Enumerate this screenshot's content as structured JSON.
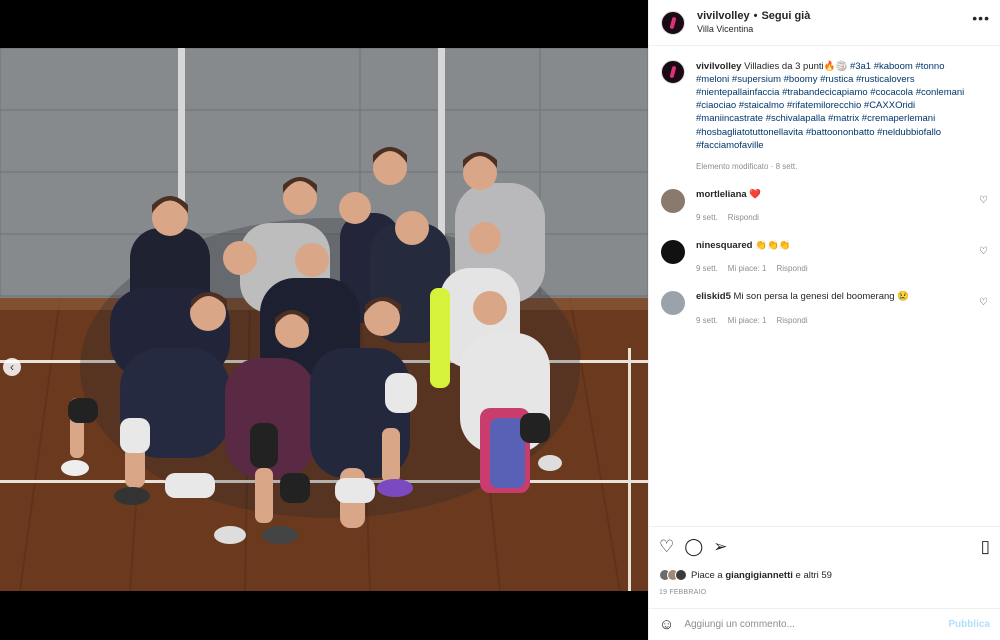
{
  "post": {
    "username": "vivilvolley",
    "separator": "•",
    "follow_label": "Segui già",
    "location": "Villa Vicentina",
    "more_icon": "more-options-icon"
  },
  "caption": {
    "username": "vivilvolley",
    "text": "Villadies da 3 punti🔥🏐 ",
    "hashtags": "#3a1 #kaboom #tonno #meloni #supersium #boomy #rustica #rusticalovers #nientepallainfaccia #trabandecicapiamo #cocacola #conlemani #ciaociao #staicalmo #rifatemilorecchio #CAXXOridi #maniincastrate #schivalapalla #matrix #cremaperlemani #hosbagliatotuttonellavita #battoononbatto #neldubbiofallo #facciamofaville",
    "meta": "Elemento modificato · 8 sett."
  },
  "comments": [
    {
      "username": "mortleliana",
      "text": "❤️",
      "time": "9 sett.",
      "likes": "",
      "reply_label": "Rispondi",
      "avatar_color": "#8a7a6e"
    },
    {
      "username": "ninesquared",
      "text": "👏👏👏",
      "time": "9 sett.",
      "likes": "Mi piace: 1",
      "reply_label": "Rispondi",
      "avatar_color": "#111111"
    },
    {
      "username": "eliskid5",
      "text": "Mi son persa la genesi del boomerang 😢",
      "time": "9 sett.",
      "likes": "Mi piace: 1",
      "reply_label": "Rispondi",
      "avatar_color": "#9aa3ac"
    }
  ],
  "actions": {
    "like_icon": "heart-icon",
    "comment_icon": "comment-icon",
    "share_icon": "share-icon",
    "save_icon": "bookmark-icon",
    "likes_prefix": "Piace a ",
    "likes_user": "giangigiannetti",
    "likes_suffix": " e altri 59",
    "date": "19 FEBBRAIO"
  },
  "compose": {
    "placeholder": "Aggiungi un commento...",
    "publish_label": "Pubblica",
    "emoji_icon": "emoji-icon"
  },
  "carousel": {
    "prev_icon": "chevron-left-icon",
    "page_count": 3,
    "active_page": 2
  },
  "colors": {
    "link": "#00376b",
    "muted": "#8e8e8e",
    "publish_disabled": "#b2dffc",
    "heart_red": "#ed4956"
  }
}
